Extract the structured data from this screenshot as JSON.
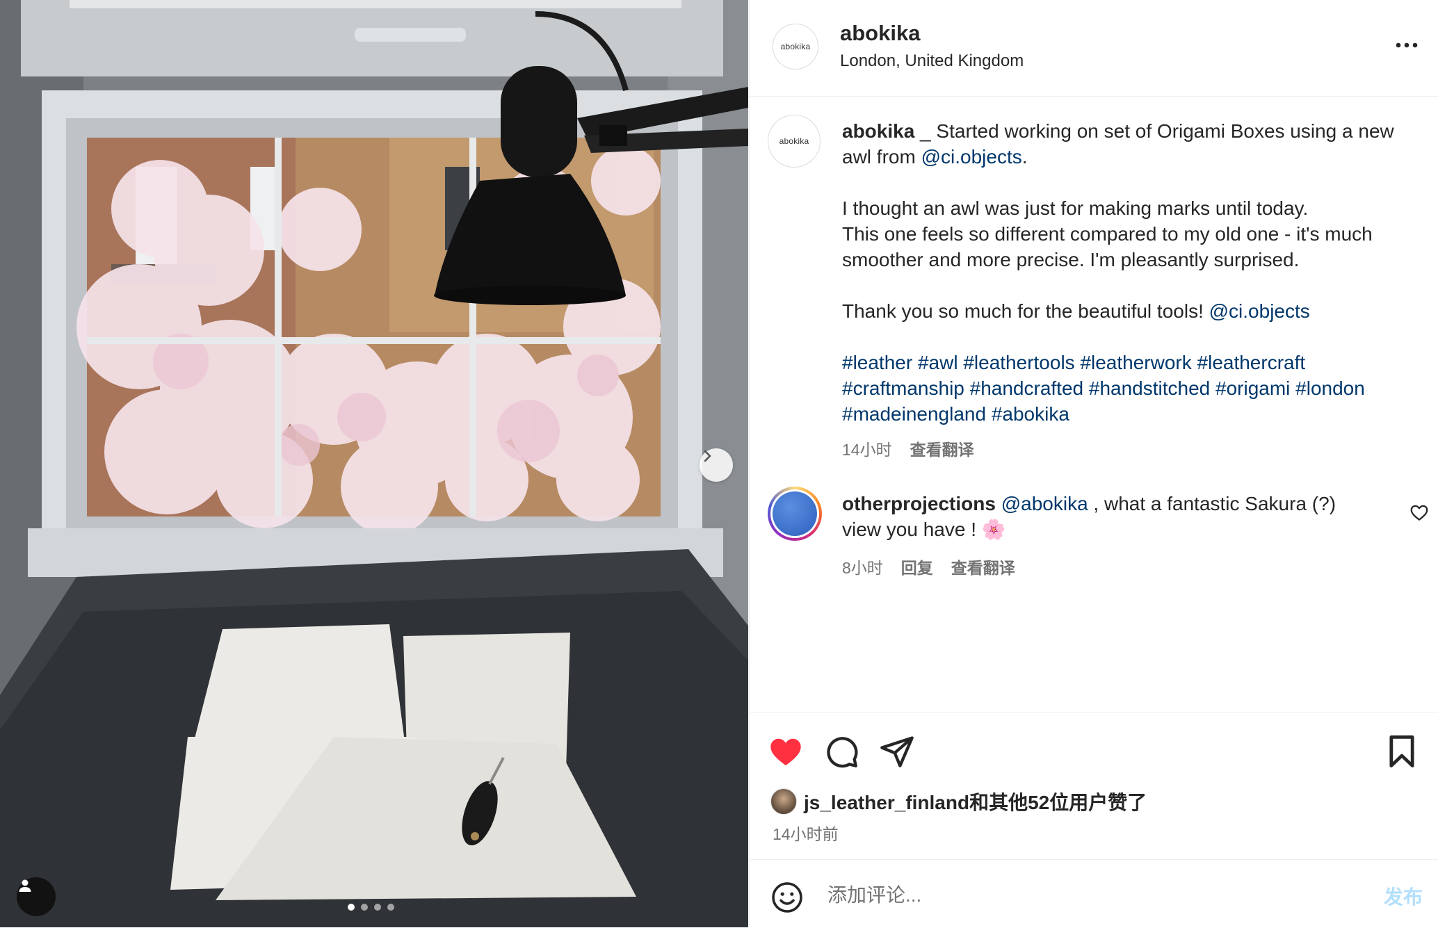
{
  "post": {
    "username": "abokika",
    "location": "London, United Kingdom",
    "avatar_text": "abokika"
  },
  "caption": {
    "username": "abokika",
    "line1": " _ Started working on set of Origami Boxes using a new awl from ",
    "mention1": "@ci.objects",
    "line1_end": ".",
    "para2_line1": "I thought an awl was just for making marks until today.",
    "para2_line2": "This one feels so different compared to my old one - it's much smoother and more precise. I'm pleasantly surprised.",
    "para3": "Thank you so much for the beautiful tools! ",
    "mention2": "@ci.objects",
    "hashtags": "#leather #awl #leathertools #leatherwork #leathercraft #craftmanship #handcrafted #handstitched #origami #london #madeinengland #abokika",
    "time": "14小时",
    "translate": "查看翻译"
  },
  "comment": {
    "username": "otherprojections",
    "mention": "@abokika",
    "text": " , what a fantastic Sakura (?) view you have ! 🌸",
    "time": "8小时",
    "reply": "回复",
    "translate": "查看翻译"
  },
  "likes": {
    "text": "js_leather_finland和其他52位用户赞了",
    "time_ago": "14小时前"
  },
  "add_comment": {
    "placeholder": "添加评论...",
    "post_label": "发布"
  },
  "carousel": {
    "count": 4,
    "active_index": 0
  },
  "colors": {
    "like_red": "#ff3040",
    "link_blue": "#00376b",
    "post_button_disabled": "#b2dffc"
  },
  "icons": [
    "next-arrow-icon",
    "user-tag-icon",
    "more-options-icon",
    "heart-icon",
    "comment-icon",
    "share-icon",
    "bookmark-icon",
    "emoji-icon"
  ]
}
